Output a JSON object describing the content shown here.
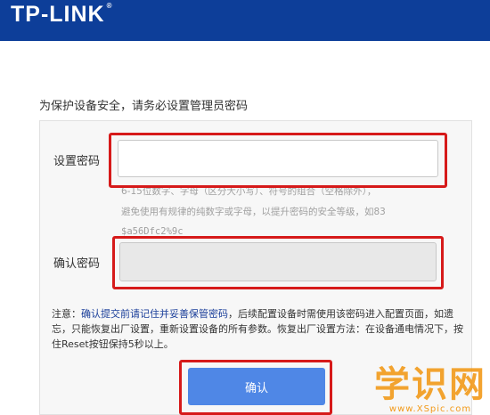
{
  "header": {
    "logo_text": "TP-LINK",
    "logo_mark": "®"
  },
  "intro_text": "为保护设备安全，请务必设置管理员密码",
  "form": {
    "password_label": "设置密码",
    "password_value": "",
    "hint_lines": [
      "6-15位数字、字母（区分大小写）、符号的组合（空格除外），",
      "避免使用有规律的纯数字或字母，以提升密码的安全等级，如83",
      "$a56Dfc2%9c"
    ],
    "confirm_label": "确认密码",
    "confirm_value": ""
  },
  "notice": {
    "prefix": "注意：",
    "highlight": "确认提交前请记住并妥善保管密码",
    "rest": "，后续配置设备时需使用该密码进入配置页面，如遗忘，只能恢复出厂设置，重新设置设备的所有参数。恢复出厂设置方法：在设备通电情况下，按住Reset按钮保持5秒以上。"
  },
  "confirm_button": "确认",
  "watermark": {
    "big": "学识网",
    "small": "www.XSpic.com"
  },
  "colors": {
    "header": "#0d3e99",
    "button": "#4f87e6",
    "annotation": "#d61a1a",
    "watermark": "#f29a1a"
  }
}
